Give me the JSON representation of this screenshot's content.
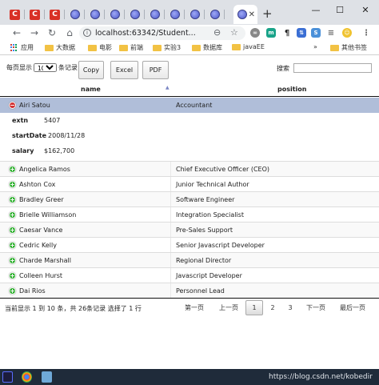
{
  "browser": {
    "tabs": [
      {
        "icon": "red-c-icon",
        "glyph": "C"
      },
      {
        "icon": "red-c-icon",
        "glyph": "C"
      },
      {
        "icon": "red-c-icon",
        "glyph": "C"
      },
      {
        "icon": "globe-icon"
      },
      {
        "icon": "globe-icon"
      },
      {
        "icon": "globe-icon"
      },
      {
        "icon": "globe-icon"
      },
      {
        "icon": "globe-icon"
      },
      {
        "icon": "globe-icon"
      },
      {
        "icon": "globe-icon"
      },
      {
        "icon": "globe-icon",
        "active": true
      }
    ],
    "url": "localhost:63342/Student...",
    "bookmarks": [
      "应用",
      "大数据",
      "电影",
      "前端",
      "实验3",
      "数据库",
      "javaEE"
    ],
    "other_bookmarks": "其他书签",
    "more": "»"
  },
  "table": {
    "length_label_pre": "每页显示",
    "length_value": "10",
    "length_label_post": "条记录",
    "buttons": {
      "copy": "Copy",
      "excel": "Excel",
      "pdf": "PDF"
    },
    "search_label": "搜索",
    "search_value": "",
    "columns": {
      "name": "name",
      "position": "position"
    },
    "rows": [
      {
        "name": "Airi Satou",
        "position": "Accountant",
        "expanded": true
      },
      {
        "name": "Angelica Ramos",
        "position": "Chief Executive Officer (CEO)"
      },
      {
        "name": "Ashton Cox",
        "position": "Junior Technical Author"
      },
      {
        "name": "Bradley Greer",
        "position": "Software Engineer"
      },
      {
        "name": "Brielle Williamson",
        "position": "Integration Specialist"
      },
      {
        "name": "Caesar Vance",
        "position": "Pre-Sales Support"
      },
      {
        "name": "Cedric Kelly",
        "position": "Senior Javascript Developer"
      },
      {
        "name": "Charde Marshall",
        "position": "Regional Director"
      },
      {
        "name": "Colleen Hurst",
        "position": "Javascript Developer"
      },
      {
        "name": "Dai Rios",
        "position": "Personnel Lead"
      }
    ],
    "detail": [
      {
        "label": "extn",
        "value": "5407"
      },
      {
        "label": "startDate",
        "value": "2008/11/28"
      },
      {
        "label": "salary",
        "value": "$162,700"
      }
    ],
    "info": "当前显示 1 到 10 条，共 26条记录   选择了 1 行",
    "pagination": {
      "first": "第一页",
      "prev": "上一页",
      "pages": [
        "1",
        "2",
        "3"
      ],
      "current": "1",
      "next": "下一页",
      "last": "最后一页"
    }
  },
  "watermark": "https://blog.csdn.net/kobedir",
  "colors": {
    "selected_row": "#b0bed9",
    "expand_plus": "#31b131",
    "expand_minus": "#d33333"
  }
}
